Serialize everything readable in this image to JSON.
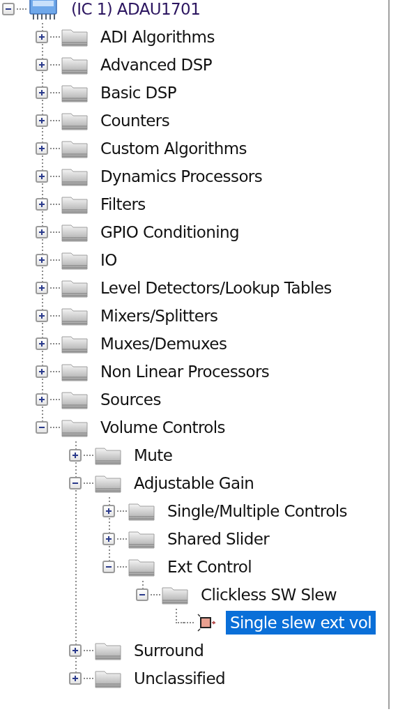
{
  "tree": [
    {
      "label": "(IC 1) ADAU1701",
      "kind": "chip",
      "expanded": true,
      "selected": false,
      "children": [
        {
          "label": "ADI Algorithms",
          "kind": "folder",
          "expanded": false,
          "selected": false
        },
        {
          "label": "Advanced DSP",
          "kind": "folder",
          "expanded": false,
          "selected": false
        },
        {
          "label": "Basic DSP",
          "kind": "folder",
          "expanded": false,
          "selected": false
        },
        {
          "label": "Counters",
          "kind": "folder",
          "expanded": false,
          "selected": false
        },
        {
          "label": "Custom Algorithms",
          "kind": "folder",
          "expanded": false,
          "selected": false
        },
        {
          "label": "Dynamics Processors",
          "kind": "folder",
          "expanded": false,
          "selected": false
        },
        {
          "label": "Filters",
          "kind": "folder",
          "expanded": false,
          "selected": false
        },
        {
          "label": "GPIO Conditioning",
          "kind": "folder",
          "expanded": false,
          "selected": false
        },
        {
          "label": "IO",
          "kind": "folder",
          "expanded": false,
          "selected": false
        },
        {
          "label": "Level Detectors/Lookup Tables",
          "kind": "folder",
          "expanded": false,
          "selected": false
        },
        {
          "label": "Mixers/Splitters",
          "kind": "folder",
          "expanded": false,
          "selected": false
        },
        {
          "label": "Muxes/Demuxes",
          "kind": "folder",
          "expanded": false,
          "selected": false
        },
        {
          "label": "Non Linear Processors",
          "kind": "folder",
          "expanded": false,
          "selected": false
        },
        {
          "label": "Sources",
          "kind": "folder",
          "expanded": false,
          "selected": false
        },
        {
          "label": "Volume Controls",
          "kind": "folder",
          "expanded": true,
          "selected": false,
          "children": [
            {
              "label": "Mute",
              "kind": "folder",
              "expanded": false,
              "selected": false
            },
            {
              "label": "Adjustable Gain",
              "kind": "folder",
              "expanded": true,
              "selected": false,
              "children": [
                {
                  "label": "Single/Multiple Controls",
                  "kind": "folder",
                  "expanded": false,
                  "selected": false
                },
                {
                  "label": "Shared Slider",
                  "kind": "folder",
                  "expanded": false,
                  "selected": false
                },
                {
                  "label": "Ext Control",
                  "kind": "folder",
                  "expanded": true,
                  "selected": false,
                  "children": [
                    {
                      "label": "Clickless SW Slew",
                      "kind": "folder",
                      "expanded": true,
                      "selected": false,
                      "children": [
                        {
                          "label": "Single slew ext vol",
                          "kind": "block",
                          "selected": true
                        }
                      ]
                    }
                  ]
                }
              ]
            },
            {
              "label": "Surround",
              "kind": "folder",
              "expanded": false,
              "selected": false
            },
            {
              "label": "Unclassified",
              "kind": "folder",
              "expanded": false,
              "selected": false
            }
          ]
        }
      ]
    }
  ]
}
